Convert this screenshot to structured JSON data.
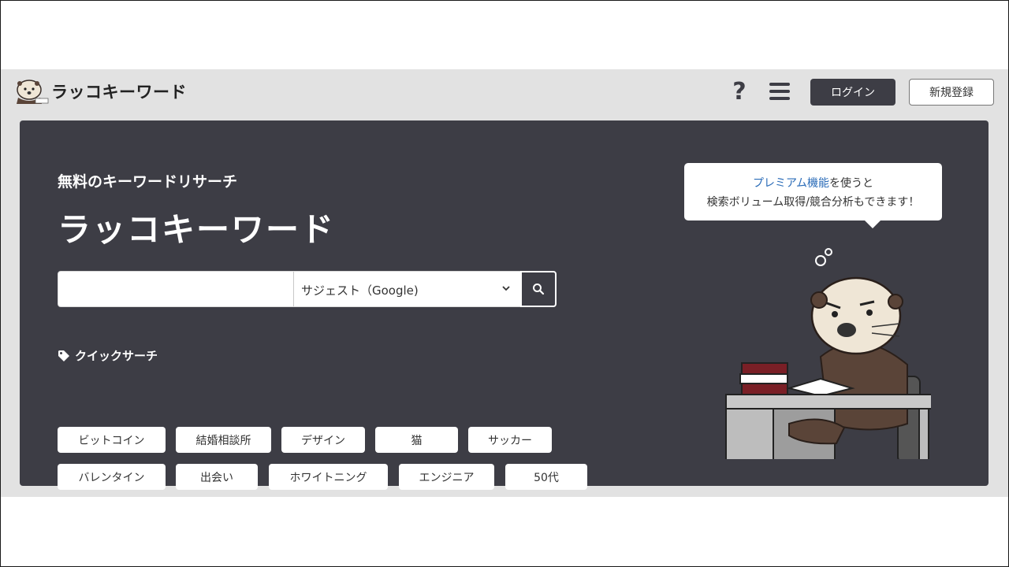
{
  "header": {
    "logo_text": "ラッコキーワード",
    "help_glyph": "?",
    "login_label": "ログイン",
    "register_label": "新規登録"
  },
  "hero": {
    "subtitle": "無料のキーワードリサーチ",
    "title": "ラッコキーワード",
    "search": {
      "input_value": "",
      "input_placeholder": "",
      "select_value": "サジェスト（Google)"
    },
    "quick_search": {
      "label": "クイックサーチ",
      "items": [
        "ビットコイン",
        "結婚相談所",
        "デザイン",
        "猫",
        "サッカー",
        "バレンタイン",
        "出会い",
        "ホワイトニング",
        "エンジニア",
        "50代"
      ]
    },
    "bubble": {
      "link": "プレミアム機能",
      "line1_rest": "を使うと",
      "line2": "検索ボリューム取得/競合分析もできます！"
    }
  },
  "icons": {
    "logo": "otter-mascot-icon",
    "help": "question-icon",
    "menu": "hamburger-menu-icon",
    "dropdown": "chevron-down-icon",
    "search": "search-icon",
    "tag": "tag-icon"
  },
  "colors": {
    "hero_bg": "#3d3d45",
    "page_bg": "#e2e2e2",
    "link": "#2b6cb8"
  }
}
